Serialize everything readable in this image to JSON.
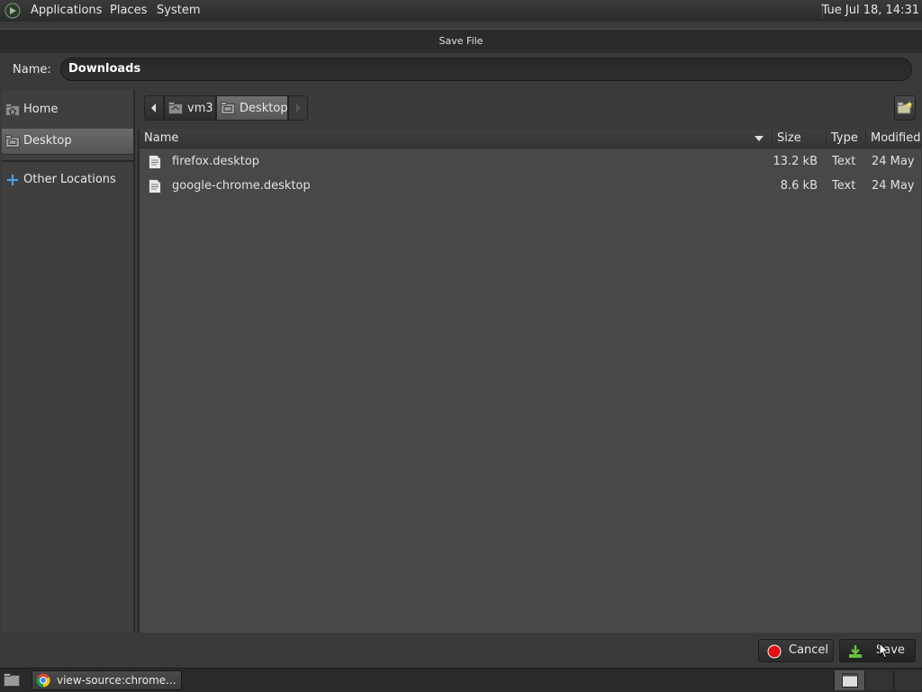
{
  "top_panel": {
    "menus": [
      "Applications",
      "Places",
      "System"
    ],
    "clock": "Tue Jul 18, 14:31"
  },
  "dialog": {
    "title": "Save File",
    "name_label": "Name:",
    "name_value": "Downloads"
  },
  "sidebar": {
    "items": [
      {
        "label": "Home",
        "icon": "home-folder-icon"
      },
      {
        "label": "Desktop",
        "icon": "desktop-folder-icon",
        "active": true
      },
      {
        "label": "Other Locations",
        "icon": "plus-icon"
      }
    ]
  },
  "pathbar": {
    "segments": [
      "vm3",
      "Desktop"
    ]
  },
  "filelist": {
    "columns": [
      "Name",
      "Size",
      "Type",
      "Modified"
    ],
    "rows": [
      {
        "name": "firefox.desktop",
        "size": "13.2 kB",
        "type": "Text",
        "modified": "24 May"
      },
      {
        "name": "google-chrome.desktop",
        "size": "8.6 kB",
        "type": "Text",
        "modified": "24 May"
      }
    ]
  },
  "buttons": {
    "cancel": "Cancel",
    "save": "Save"
  },
  "taskbar": {
    "app_label": "view-source:chrome..."
  }
}
